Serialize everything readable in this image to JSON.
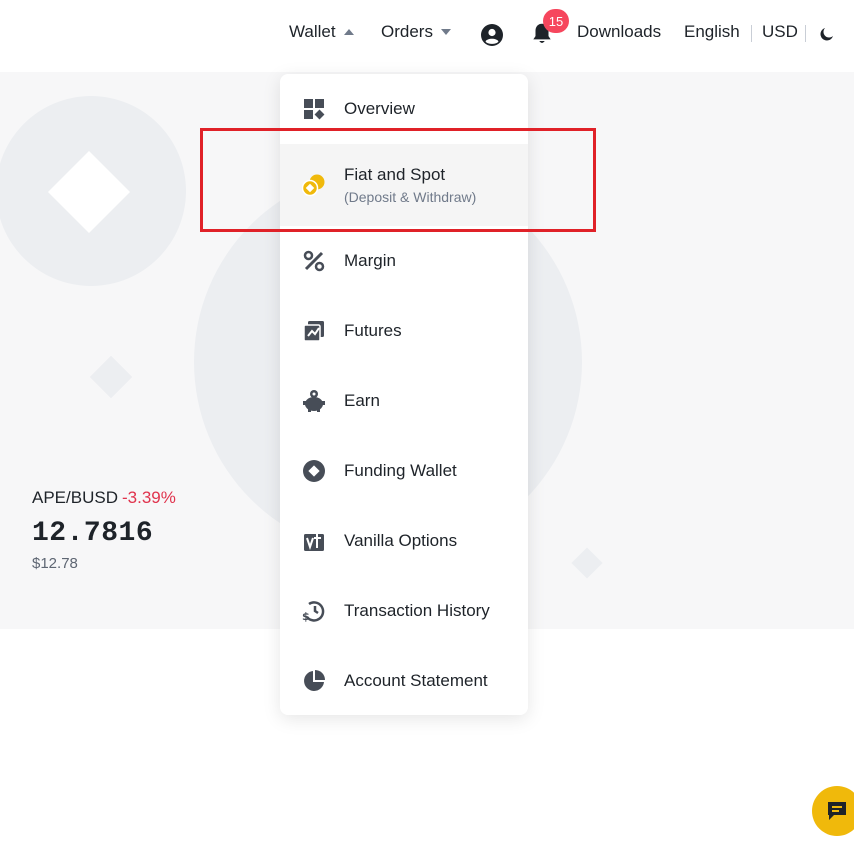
{
  "header": {
    "wallet_label": "Wallet",
    "orders_label": "Orders",
    "notification_count": "15",
    "downloads_label": "Downloads",
    "language_label": "English",
    "currency_label": "USD"
  },
  "ticker": {
    "pair": "APE/BUSD",
    "change": "-3.39%",
    "price": "12.7816",
    "usd_price": "$12.78"
  },
  "wallet_menu": {
    "items": [
      {
        "label": "Overview",
        "icon": "overview-icon"
      },
      {
        "label": "Fiat and Spot",
        "sublabel": "(Deposit & Withdraw)",
        "icon": "fiat-spot-icon"
      },
      {
        "label": "Margin",
        "icon": "percent-icon"
      },
      {
        "label": "Futures",
        "icon": "futures-icon"
      },
      {
        "label": "Earn",
        "icon": "piggy-bank-icon"
      },
      {
        "label": "Funding Wallet",
        "icon": "funding-icon"
      },
      {
        "label": "Vanilla Options",
        "icon": "options-icon"
      },
      {
        "label": "Transaction History",
        "icon": "history-icon"
      },
      {
        "label": "Account Statement",
        "icon": "pie-chart-icon"
      }
    ]
  },
  "colors": {
    "accent": "#f0b90b",
    "negative": "#e0334d",
    "highlight_box": "#e02128",
    "icon": "#474d57"
  }
}
